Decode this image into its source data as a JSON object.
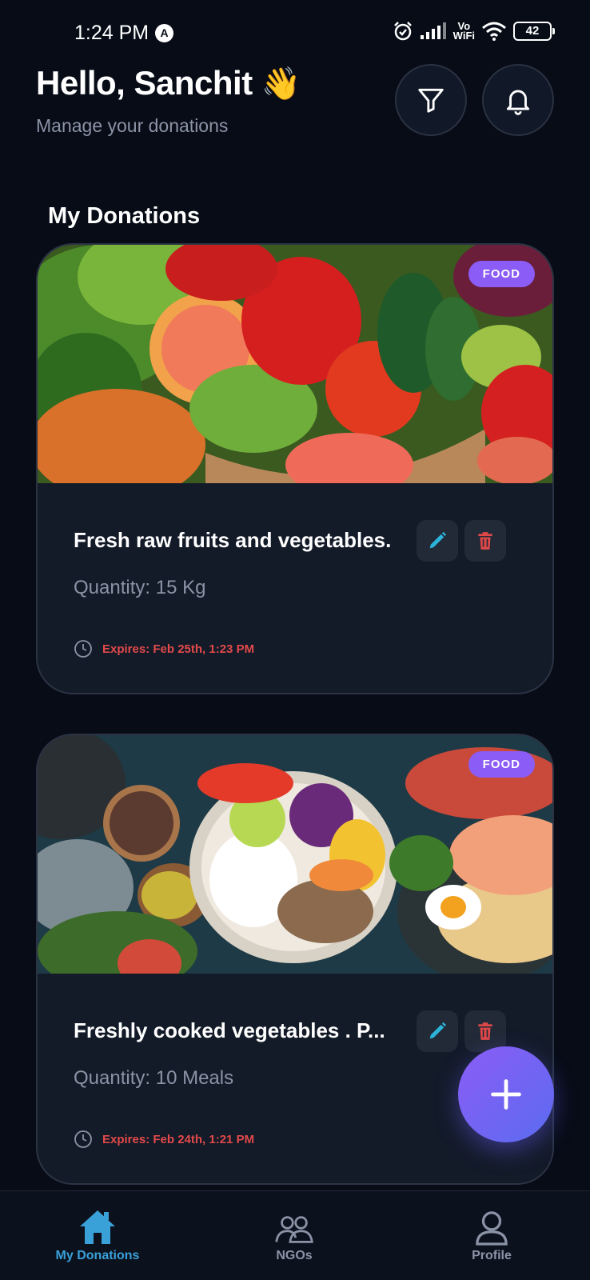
{
  "status_bar": {
    "time": "1:24 PM",
    "vowifi_top": "Vo",
    "vowifi_bottom": "WiFi",
    "battery": "42"
  },
  "header": {
    "greeting": "Hello, Sanchit",
    "wave_emoji": "👋",
    "subtitle": "Manage your donations",
    "filter_icon": "filter-icon",
    "bell_icon": "bell-icon"
  },
  "section_title": "My Donations",
  "donations": [
    {
      "tag": "FOOD",
      "title": "Fresh raw fruits and vegetables.",
      "quantity": "Quantity: 15 Kg",
      "expiry": "Expires: Feb 25th, 1:23 PM"
    },
    {
      "tag": "FOOD",
      "title": "Freshly cooked vegetables . P...",
      "quantity": "Quantity: 10 Meals",
      "expiry": "Expires: Feb 24th, 1:21 PM"
    }
  ],
  "bottom_nav": [
    {
      "label": "My Donations",
      "icon": "home-icon",
      "active": true
    },
    {
      "label": "NGOs",
      "icon": "people-icon",
      "active": false
    },
    {
      "label": "Profile",
      "icon": "user-icon",
      "active": false
    }
  ],
  "colors": {
    "background": "#070c17",
    "card": "#131a28",
    "accent_purple": "#8b5cf6",
    "expiry_red": "#e24a4a",
    "active_nav": "#3aa0d8",
    "edit_icon": "#2bb3d9",
    "delete_icon": "#e04848"
  }
}
